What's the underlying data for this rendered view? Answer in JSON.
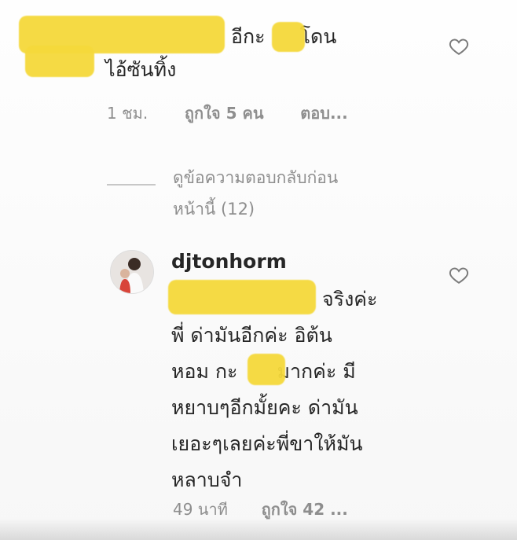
{
  "comment1": {
    "line1_text": "อีกะ",
    "line1_after": "โดน",
    "line2_text": "ไอ้ซันทิ้ง",
    "time": "1 ชม.",
    "likes": "ถูกใจ 5 คน",
    "reply": "ตอบ..."
  },
  "view_replies": {
    "line1": "ดูข้อความตอบกลับก่อน",
    "line2": "หน้านี้ (12)"
  },
  "comment2": {
    "username": "djtonhorm",
    "line1_after": "จริงค่ะ",
    "line2": "พี่ ด่ามันอีกค่ะ อิต้น",
    "line3_before": "หอม กะ",
    "line3_after": "มากค่ะ มี",
    "line4": "หยาบๆอีกมั้ยคะ ด่ามัน",
    "line5": "เยอะๆเลยค่ะพี่ขาให้มัน",
    "line6": "หลาบจำ",
    "time": "49 นาที",
    "likes": "ถูกใจ 42 ..."
  },
  "icons": {
    "like1": "heart-outline-icon",
    "like2": "heart-outline-icon",
    "avatar": "user-avatar"
  },
  "colors": {
    "redaction": "#f5d93b",
    "meta_text": "#8e8e8e"
  }
}
